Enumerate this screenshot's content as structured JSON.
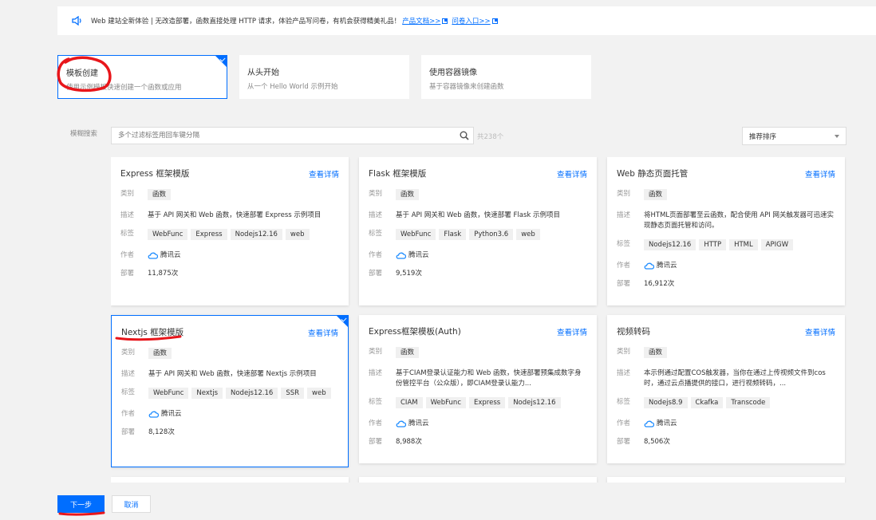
{
  "notice": {
    "text": "Web 建站全新体验 | 无改造部署，函数直接处理 HTTP 请求，体验产品写问卷，有机会获得精美礼品！",
    "link_docs": "产品文档>>",
    "link_survey": "问卷入口>>"
  },
  "modes": [
    {
      "title": "模板创建",
      "desc": "使用示例模板快速创建一个函数或应用"
    },
    {
      "title": "从头开始",
      "desc": "从一个 Hello World 示例开始"
    },
    {
      "title": "使用容器镜像",
      "desc": "基于容器镜像来创建函数"
    }
  ],
  "search": {
    "label": "模糊搜索",
    "placeholder": "多个过滤标签用回车键分隔",
    "count": "共238个",
    "sort": "推荐排序"
  },
  "labels": {
    "category": "类别",
    "desc": "描述",
    "tags": "标签",
    "author": "作者",
    "deploys": "部署",
    "detail": "查看详情"
  },
  "templates": [
    {
      "name": "Express 框架模版",
      "category": "函数",
      "desc": "基于 API 网关和 Web 函数，快速部署 Express 示例项目",
      "tags": [
        "WebFunc",
        "Express",
        "Nodejs12.16",
        "web"
      ],
      "author": "腾讯云",
      "deploys": "11,875次"
    },
    {
      "name": "Flask 框架模版",
      "category": "函数",
      "desc": "基于 API 网关和 Web 函数，快速部署 Flask 示例项目",
      "tags": [
        "WebFunc",
        "Flask",
        "Python3.6",
        "web"
      ],
      "author": "腾讯云",
      "deploys": "9,519次"
    },
    {
      "name": "Web 静态页面托管",
      "category": "函数",
      "desc": "将HTML页面部署至云函数，配合使用 API 网关触发器可迅速实现静态页面托管和访问。",
      "tags": [
        "Nodejs12.16",
        "HTTP",
        "HTML",
        "APIGW"
      ],
      "author": "腾讯云",
      "deploys": "16,912次"
    },
    {
      "name": "Nextjs 框架模版",
      "category": "函数",
      "desc": "基于 API 网关和 Web 函数，快速部署 Nextjs 示例项目",
      "tags": [
        "WebFunc",
        "Nextjs",
        "Nodejs12.16",
        "SSR",
        "web"
      ],
      "author": "腾讯云",
      "deploys": "8,128次"
    },
    {
      "name": "Express框架模板(Auth)",
      "category": "函数",
      "desc": "基于CIAM登录认证能力和 Web 函数，快速部署预集成数字身份管控平台（公众版），即CIAM登录认能力...",
      "tags": [
        "CIAM",
        "WebFunc",
        "Express",
        "Nodejs12.16"
      ],
      "author": "腾讯云",
      "deploys": "8,988次"
    },
    {
      "name": "视频转码",
      "category": "函数",
      "desc": "本示例通过配置COS触发器，当你在通过上传视频文件到cos时，通过云点播提供的接口，进行视频转码，...",
      "tags": [
        "Nodejs8.9",
        "Ckafka",
        "Transcode"
      ],
      "author": "腾讯云",
      "deploys": "8,506次"
    }
  ],
  "actions": {
    "next": "下一步",
    "cancel": "取消"
  },
  "colors": {
    "accent": "#006eff",
    "annotation": "#e8161b"
  }
}
